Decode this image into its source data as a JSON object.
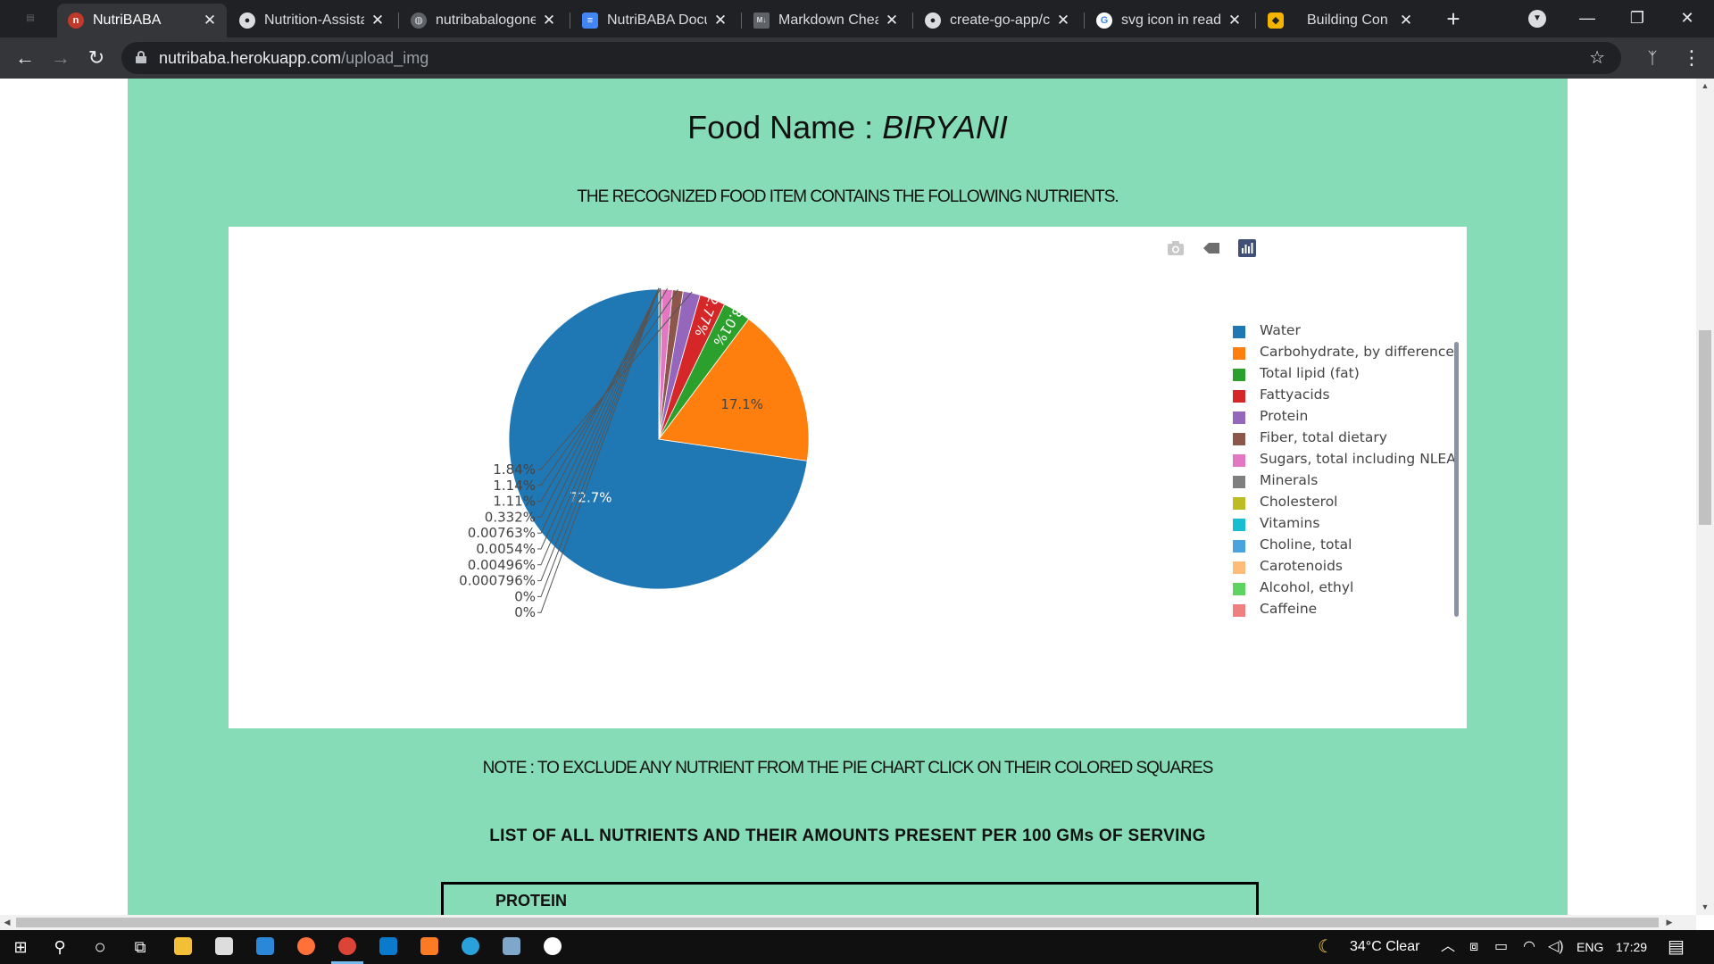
{
  "browser": {
    "tabs": [
      {
        "title": "NutriBABA",
        "favicon": "app-favicon",
        "active": true
      },
      {
        "title": "Nutrition-Assista",
        "favicon": "github-icon"
      },
      {
        "title": "nutribabalogone",
        "favicon": "globe-icon"
      },
      {
        "title": "NutriBABA Docur",
        "favicon": "docs-icon"
      },
      {
        "title": "Markdown Cheat",
        "favicon": "markdown-icon"
      },
      {
        "title": "create-go-app/cl",
        "favicon": "github-icon"
      },
      {
        "title": "svg icon in readn",
        "favicon": "google-icon"
      },
      {
        "title": "Building Con",
        "favicon": "bookmark-icon"
      }
    ],
    "url_domain": "nutribaba.herokuapp.com",
    "url_path": "/upload_img",
    "window_controls": {
      "minimize": "—",
      "maximize": "❐",
      "close": "✕"
    }
  },
  "page": {
    "food_label": "Food Name : ",
    "food_name": "BIRYANI",
    "subtitle": "THE RECOGNIZED FOOD ITEM CONTAINS THE FOLLOWING NUTRIENTS.",
    "note": "NOTE : TO EXCLUDE ANY NUTRIENT FROM THE PIE CHART CLICK ON THEIR COLORED SQUARES",
    "list_heading": "LIST OF ALL NUTRIENTS AND THEIR AMOUNTS PRESENT PER 100 GMs OF SERVING",
    "table_first_cell": "PROTEIN"
  },
  "chart_data": {
    "type": "pie",
    "title": "",
    "legend_position": "right",
    "slices": [
      {
        "label": "Water",
        "value": 72.7,
        "text": "72.7%",
        "color": "#1f77b4"
      },
      {
        "label": "Carbohydrate, by difference",
        "value": 17.1,
        "text": "17.1%",
        "color": "#ff7f0e"
      },
      {
        "label": "Total lipid (fat)",
        "value": 3.01,
        "text": "3.01%",
        "color": "#2ca02c"
      },
      {
        "label": "Fattyacids",
        "value": 2.77,
        "text": "2.77%",
        "color": "#d62728"
      },
      {
        "label": "Protein",
        "value": 1.84,
        "text": "1.84%",
        "color": "#9467bd"
      },
      {
        "label": "Fiber, total dietary",
        "value": 1.14,
        "text": "1.14%",
        "color": "#8c564b"
      },
      {
        "label": "Sugars, total including NLEA",
        "value": 1.11,
        "text": "1.11%",
        "color": "#e377c2"
      },
      {
        "label": "Minerals",
        "value": 0.332,
        "text": "0.332%",
        "color": "#7f7f7f"
      },
      {
        "label": "Cholesterol",
        "value": 0.00763,
        "text": "0.00763%",
        "color": "#bcbd22"
      },
      {
        "label": "Vitamins",
        "value": 0.0054,
        "text": "0.0054%",
        "color": "#17becf"
      },
      {
        "label": "Choline, total",
        "value": 0.00496,
        "text": "0.00496%",
        "color": "#4aa3df"
      },
      {
        "label": "Carotenoids",
        "value": 0.000796,
        "text": "0.000796%",
        "color": "#ffbb78"
      },
      {
        "label": "Alcohol, ethyl",
        "value": 0,
        "text": "0%",
        "color": "#5fd35f"
      },
      {
        "label": "Caffeine",
        "value": 0,
        "text": "0%",
        "color": "#f08080"
      }
    ]
  },
  "modebar": [
    "camera-icon",
    "tag-icon",
    "plotly-logo-icon"
  ],
  "taskbar": {
    "weather": "34°C  Clear",
    "language": "ENG",
    "time": "17:29"
  }
}
